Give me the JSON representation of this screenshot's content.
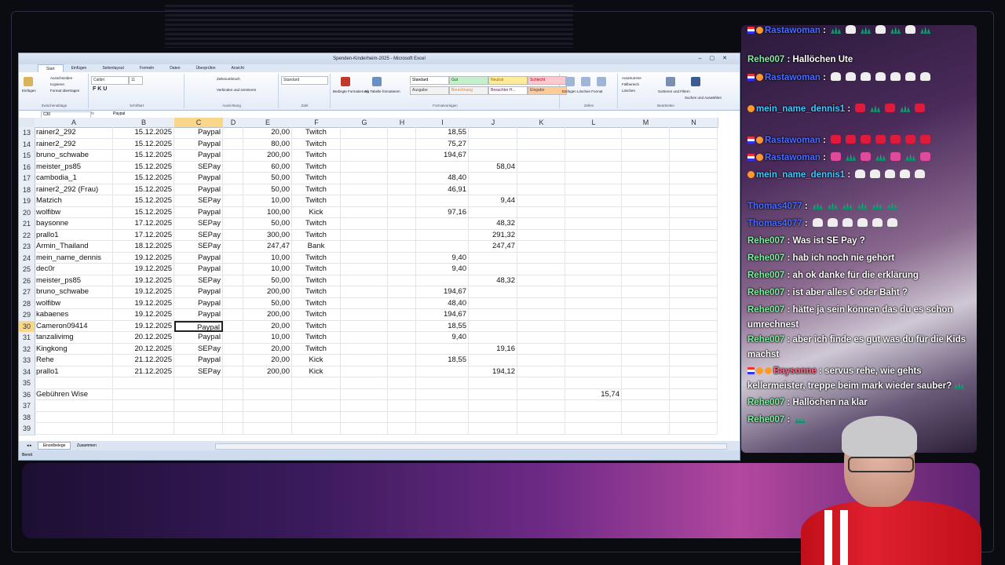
{
  "excel": {
    "title": "Spenden-Kinderheim-2025 - Microsoft Excel",
    "tabs": [
      "Start",
      "Einfügen",
      "Seitenlayout",
      "Formeln",
      "Daten",
      "Überprüfen",
      "Ansicht"
    ],
    "name_box": "C30",
    "formula_value": "Paypal",
    "ribbon": {
      "groups": [
        "Zwischenablage",
        "Schriftart",
        "Ausrichtung",
        "Zahl",
        "Formatvorlagen",
        "Zellen",
        "Bearbeiten"
      ],
      "font_name": "Calibri",
      "font_size": "11",
      "number_format": "Standard",
      "paste": "Einfügen",
      "cut": "Ausschneiden",
      "copy": "Kopieren",
      "format_painter": "Format übertragen",
      "wrap": "Zeilenumbruch",
      "merge": "Verbinden und zentrieren",
      "cond_format": "Bedingte Formatierung",
      "as_table": "Als Tabelle formatieren",
      "styles": [
        {
          "label": "Standard",
          "bg": "#ffffff",
          "fg": "#000000"
        },
        {
          "label": "Gut",
          "bg": "#c6efce",
          "fg": "#006100"
        },
        {
          "label": "Neutral",
          "bg": "#ffeb9c",
          "fg": "#9c6500"
        },
        {
          "label": "Schlecht",
          "bg": "#ffc7ce",
          "fg": "#9c0006"
        },
        {
          "label": "Ausgabe",
          "bg": "#f2f2f2",
          "fg": "#3f3f3f"
        },
        {
          "label": "Berechnung",
          "bg": "#f2f2f2",
          "fg": "#fa7d00"
        },
        {
          "label": "Besuchter H...",
          "bg": "#ffffff",
          "fg": "#800080"
        },
        {
          "label": "Eingabe",
          "bg": "#ffcc99",
          "fg": "#3f3f76"
        }
      ],
      "cells_ops": "Einfügen Löschen Format",
      "autosum": "AutoSumme",
      "fill": "Füllbereich",
      "clear": "Löschen",
      "sort": "Sortieren und Filtern",
      "find": "Suchen und Auswählen"
    },
    "columns": [
      "A",
      "B",
      "C",
      "D",
      "E",
      "F",
      "G",
      "H",
      "I",
      "J",
      "K",
      "L",
      "M",
      "N"
    ],
    "rows": [
      {
        "n": "13",
        "a": "rainer2_292",
        "b": "15.12.2025",
        "c": "Paypal",
        "e": "20,00",
        "f": "Twitch",
        "i": "18,55",
        "j": "",
        "l": ""
      },
      {
        "n": "14",
        "a": "rainer2_292",
        "b": "15.12.2025",
        "c": "Paypal",
        "e": "80,00",
        "f": "Twitch",
        "i": "75,27",
        "j": "",
        "l": ""
      },
      {
        "n": "15",
        "a": "bruno_schwabe",
        "b": "15.12.2025",
        "c": "Paypal",
        "e": "200,00",
        "f": "Twitch",
        "i": "194,67",
        "j": "",
        "l": ""
      },
      {
        "n": "16",
        "a": "meister_ps85",
        "b": "15.12.2025",
        "c": "SEPay",
        "e": "60,00",
        "f": "Twitch",
        "i": "",
        "j": "58,04",
        "l": ""
      },
      {
        "n": "17",
        "a": "cambodia_1",
        "b": "15.12.2025",
        "c": "Paypal",
        "e": "50,00",
        "f": "Twitch",
        "i": "48,40",
        "j": "",
        "l": ""
      },
      {
        "n": "18",
        "a": "rainer2_292 (Frau)",
        "b": "15.12.2025",
        "c": "Paypal",
        "e": "50,00",
        "f": "Twitch",
        "i": "46,91",
        "j": "",
        "l": ""
      },
      {
        "n": "19",
        "a": "Matzich",
        "b": "15.12.2025",
        "c": "SEPay",
        "e": "10,00",
        "f": "Twitch",
        "i": "",
        "j": "9,44",
        "l": ""
      },
      {
        "n": "20",
        "a": "wolfibw",
        "b": "15.12.2025",
        "c": "Paypal",
        "e": "100,00",
        "f": "Kick",
        "i": "97,16",
        "j": "",
        "l": ""
      },
      {
        "n": "21",
        "a": "baysonne",
        "b": "17.12.2025",
        "c": "SEPay",
        "e": "50,00",
        "f": "Twitch",
        "i": "",
        "j": "48,32",
        "l": ""
      },
      {
        "n": "22",
        "a": "prallo1",
        "b": "17.12.2025",
        "c": "SEPay",
        "e": "300,00",
        "f": "Twitch",
        "i": "",
        "j": "291,32",
        "l": ""
      },
      {
        "n": "23",
        "a": "Armin_Thailand",
        "b": "18.12.2025",
        "c": "SEPay",
        "e": "247,47",
        "f": "Bank",
        "i": "",
        "j": "247,47",
        "l": ""
      },
      {
        "n": "24",
        "a": "mein_name_dennis",
        "b": "19.12.2025",
        "c": "Paypal",
        "e": "10,00",
        "f": "Twitch",
        "i": "9,40",
        "j": "",
        "l": ""
      },
      {
        "n": "25",
        "a": "dec0r",
        "b": "19.12.2025",
        "c": "Paypal",
        "e": "10,00",
        "f": "Twitch",
        "i": "9,40",
        "j": "",
        "l": ""
      },
      {
        "n": "26",
        "a": "meister_ps85",
        "b": "19.12.2025",
        "c": "SEPay",
        "e": "50,00",
        "f": "Twitch",
        "i": "",
        "j": "48,32",
        "l": ""
      },
      {
        "n": "27",
        "a": "bruno_schwabe",
        "b": "19.12.2025",
        "c": "Paypal",
        "e": "200,00",
        "f": "Twitch",
        "i": "194,67",
        "j": "",
        "l": ""
      },
      {
        "n": "28",
        "a": "wolfibw",
        "b": "19.12.2025",
        "c": "Paypal",
        "e": "50,00",
        "f": "Twitch",
        "i": "48,40",
        "j": "",
        "l": ""
      },
      {
        "n": "29",
        "a": "kabaenes",
        "b": "19.12.2025",
        "c": "Paypal",
        "e": "200,00",
        "f": "Twitch",
        "i": "194,67",
        "j": "",
        "l": ""
      },
      {
        "n": "30",
        "a": "Cameron09414",
        "b": "19.12.2025",
        "c": "Paypal",
        "e": "20,00",
        "f": "Twitch",
        "i": "18,55",
        "j": "",
        "l": ""
      },
      {
        "n": "31",
        "a": "tanzalivimg",
        "b": "20.12.2025",
        "c": "Paypal",
        "e": "10,00",
        "f": "Twitch",
        "i": "9,40",
        "j": "",
        "l": ""
      },
      {
        "n": "32",
        "a": "Kingkong",
        "b": "20.12.2025",
        "c": "SEPay",
        "e": "20,00",
        "f": "Twitch",
        "i": "",
        "j": "19,16",
        "l": ""
      },
      {
        "n": "33",
        "a": "Rehe",
        "b": "21.12.2025",
        "c": "Paypal",
        "e": "20,00",
        "f": "Kick",
        "i": "18,55",
        "j": "",
        "l": ""
      },
      {
        "n": "34",
        "a": "prallo1",
        "b": "21.12.2025",
        "c": "SEPay",
        "e": "200,00",
        "f": "Kick",
        "i": "",
        "j": "194,12",
        "l": ""
      },
      {
        "n": "35",
        "a": "",
        "b": "",
        "c": "",
        "e": "",
        "f": "",
        "i": "",
        "j": "",
        "l": ""
      },
      {
        "n": "36",
        "a": "Gebühren Wise",
        "b": "",
        "c": "",
        "e": "",
        "f": "",
        "i": "",
        "j": "",
        "l": "15,74"
      },
      {
        "n": "37",
        "a": "",
        "b": "",
        "c": "",
        "e": "",
        "f": "",
        "i": "",
        "j": "",
        "l": ""
      },
      {
        "n": "38",
        "a": "",
        "b": "",
        "c": "",
        "e": "",
        "f": "",
        "i": "",
        "j": "",
        "l": ""
      },
      {
        "n": "39",
        "a": "",
        "b": "",
        "c": "",
        "e": "",
        "f": "",
        "i": "",
        "j": "",
        "l": ""
      }
    ],
    "active_row": "30",
    "sheet_tabs": [
      "Einzelbelege",
      "Zusammen"
    ],
    "status": "Bereit"
  },
  "chat": {
    "messages": [
      {
        "user": "Rastawoman",
        "color": "u-blue",
        "badges": [
          "b-flag",
          "b-orange"
        ],
        "text": "",
        "emotes": [
          "em-g",
          "em-w",
          "em-g",
          "em-w",
          "em-g",
          "em-w",
          "em-g"
        ]
      },
      {
        "user": "Rehe007",
        "color": "u-green",
        "badges": [],
        "text": "Hallöchen Ute",
        "emotes": []
      },
      {
        "user": "Rastawoman",
        "color": "u-blue",
        "badges": [
          "b-flag",
          "b-orange"
        ],
        "text": "",
        "emotes": [
          "em-w",
          "em-w",
          "em-w",
          "em-w",
          "em-w",
          "em-w",
          "em-w"
        ]
      },
      {
        "user": "mein_name_dennis1",
        "color": "u-cyan",
        "badges": [
          "b-orange"
        ],
        "text": "",
        "emotes": [
          "em-r",
          "em-g",
          "em-r",
          "em-g",
          "em-r"
        ]
      },
      {
        "user": "Rastawoman",
        "color": "u-blue",
        "badges": [
          "b-flag",
          "b-orange"
        ],
        "text": "",
        "emotes": [
          "em-r",
          "em-r",
          "em-r",
          "em-r",
          "em-r",
          "em-r",
          "em-r"
        ]
      },
      {
        "user": "Rastawoman",
        "color": "u-blue",
        "badges": [
          "b-flag",
          "b-orange"
        ],
        "text": "",
        "emotes": [
          "em-p",
          "em-g",
          "em-p",
          "em-g",
          "em-p",
          "em-g",
          "em-p"
        ]
      },
      {
        "user": "mein_name_dennis1",
        "color": "u-cyan",
        "badges": [
          "b-orange"
        ],
        "text": "",
        "emotes": [
          "em-w",
          "em-w",
          "em-w",
          "em-w",
          "em-w"
        ]
      },
      {
        "user": "Thomas4077",
        "color": "u-blue",
        "badges": [],
        "text": "",
        "emotes": [
          "em-g",
          "em-g",
          "em-g",
          "em-g",
          "em-g",
          "em-g"
        ]
      },
      {
        "user": "Thomas4077",
        "color": "u-blue",
        "badges": [],
        "text": "",
        "emotes": [
          "em-w",
          "em-w",
          "em-w",
          "em-w",
          "em-w",
          "em-w"
        ]
      },
      {
        "user": "Rehe007",
        "color": "u-green",
        "badges": [],
        "text": "Was ist SE Pay ?",
        "emotes": []
      },
      {
        "user": "Rehe007",
        "color": "u-green",
        "badges": [],
        "text": "hab ich noch nie gehört",
        "emotes": []
      },
      {
        "user": "Rehe007",
        "color": "u-green",
        "badges": [],
        "text": "ah ok danke für die erklärung",
        "emotes": []
      },
      {
        "user": "Rehe007",
        "color": "u-green",
        "badges": [],
        "text": "ist aber alles € oder Baht ?",
        "emotes": []
      },
      {
        "user": "Rehe007",
        "color": "u-green",
        "badges": [],
        "text": "hätte ja sein können das du es schon umrechnest",
        "emotes": []
      },
      {
        "user": "Rehe007",
        "color": "u-green",
        "badges": [],
        "text": "aber ich finde es gut was du für die Kids machst",
        "emotes": []
      },
      {
        "user": "Baysonne",
        "color": "u-red",
        "badges": [
          "b-flag",
          "b-orange",
          "b-orange"
        ],
        "text": "servus rehe, wie gehts kellermeister, treppe beim mark wieder sauber?",
        "emotes": [
          "em-g"
        ]
      },
      {
        "user": "Rehe007",
        "color": "u-green",
        "badges": [],
        "text": "Hallöchen na klar",
        "emotes": []
      },
      {
        "user": "Rehe007",
        "color": "u-green",
        "badges": [],
        "text": "",
        "emotes": [
          "em-g"
        ]
      }
    ]
  }
}
